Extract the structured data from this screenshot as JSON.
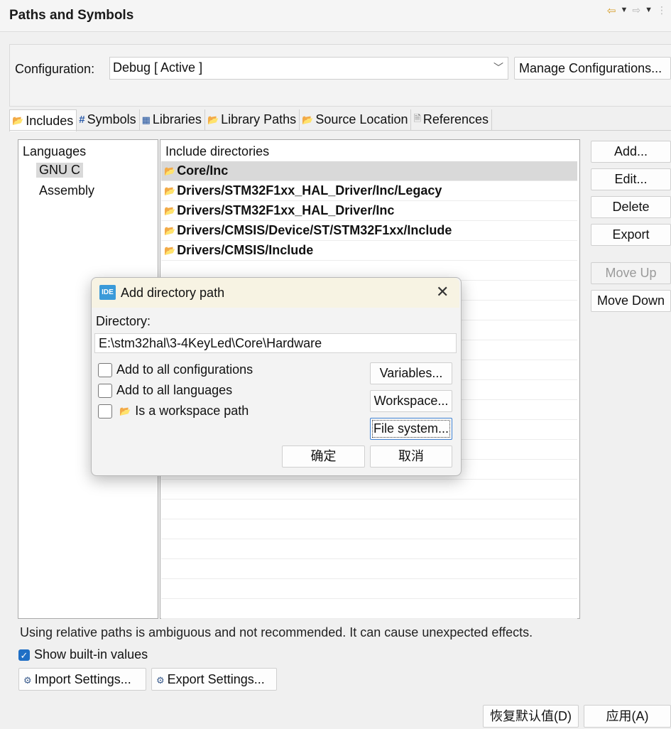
{
  "header": {
    "title": "Paths and Symbols"
  },
  "config": {
    "label": "Configuration:",
    "selected": "Debug  [ Active ]",
    "manage_label": "Manage Configurations..."
  },
  "tabs": [
    {
      "label": "Includes",
      "icon": "folder-include-icon"
    },
    {
      "label": "Symbols",
      "icon": "hash-icon"
    },
    {
      "label": "Libraries",
      "icon": "library-icon"
    },
    {
      "label": "Library Paths",
      "icon": "folder-library-icon"
    },
    {
      "label": "Source Location",
      "icon": "folder-source-icon"
    },
    {
      "label": "References",
      "icon": "document-icon"
    }
  ],
  "languages": {
    "header": "Languages",
    "items": [
      "GNU C",
      "Assembly"
    ]
  },
  "includes": {
    "header": "Include directories",
    "rows": [
      "Core/Inc",
      "Drivers/STM32F1xx_HAL_Driver/Inc/Legacy",
      "Drivers/STM32F1xx_HAL_Driver/Inc",
      "Drivers/CMSIS/Device/ST/STM32F1xx/Include",
      "Drivers/CMSIS/Include"
    ]
  },
  "side_buttons": {
    "add": "Add...",
    "edit": "Edit...",
    "delete": "Delete",
    "export": "Export",
    "move_up": "Move Up",
    "move_down": "Move Down"
  },
  "footer": {
    "warning": "Using relative paths is ambiguous and not recommended. It can cause unexpected effects.",
    "show_builtin": "Show built-in values",
    "import_settings": "Import Settings...",
    "export_settings": "Export Settings...",
    "restore_defaults": "恢复默认值(D)",
    "apply": "应用(A)"
  },
  "dialog": {
    "logo": "IDE",
    "title": "Add directory path",
    "directory_label": "Directory:",
    "directory_value": "E:\\stm32hal\\3-4KeyLed\\Core\\Hardware",
    "add_all_configs": "Add to all configurations",
    "add_all_langs": "Add to all languages",
    "workspace_path": "Is a workspace path",
    "variables": "Variables...",
    "workspace": "Workspace...",
    "file_system": "File system...",
    "ok": "确定",
    "cancel": "取消"
  }
}
